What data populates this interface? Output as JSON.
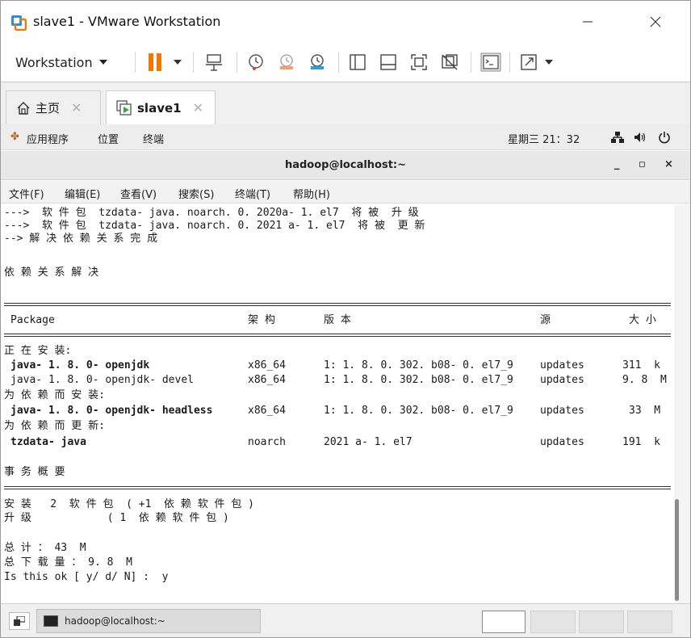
{
  "window": {
    "title": "slave1 - VMware Workstation"
  },
  "toolbar": {
    "workstation_label": "Workstation",
    "accent": "#f07800"
  },
  "tabs": [
    {
      "label": "主页",
      "icon": "home-icon"
    },
    {
      "label": "slave1",
      "icon": "vm-running-icon"
    }
  ],
  "guest_panel": {
    "applications": "应用程序",
    "places": "位置",
    "terminal": "终端",
    "datetime": "星期三 21：32"
  },
  "terminal_window": {
    "title": "hadoop@localhost:~",
    "minimize": "_",
    "maximize": "▫",
    "close": "×"
  },
  "terminal_menu": [
    "文件(F)",
    "编辑(E)",
    "查看(V)",
    "搜索(S)",
    "终端(T)",
    "帮助(H)"
  ],
  "terminal": {
    "lines": [
      "--->  软 件 包  tzdata- java. noarch. 0. 2020a- 1. el7  将 被  升 级",
      "--->  软 件 包  tzdata- java. noarch. 0. 2021 a- 1. el7  将 被  更 新",
      "--> 解 决 依 赖 关 系 完 成",
      "",
      "依 赖 关 系 解 决"
    ],
    "table_header": {
      "package": "Package",
      "arch": "架 构",
      "version": "版 本",
      "repo": "源",
      "size": "大 小"
    },
    "sections": [
      {
        "heading": "正 在 安 装:",
        "rows": [
          {
            "name": "java- 1. 8. 0- openjdk",
            "arch": "x86_64",
            "version": "1: 1. 8. 0. 302. b08- 0. el7_9",
            "repo": "updates",
            "size": "311  k",
            "bold": true
          },
          {
            "name": "java- 1. 8. 0- openjdk- devel",
            "arch": "x86_64",
            "version": "1: 1. 8. 0. 302. b08- 0. el7_9",
            "repo": "updates",
            "size": "9. 8  M",
            "bold": false
          }
        ]
      },
      {
        "heading": "为 依 赖 而 安 装:",
        "rows": [
          {
            "name": "java- 1. 8. 0- openjdk- headless",
            "arch": "x86_64",
            "version": "1: 1. 8. 0. 302. b08- 0. el7_9",
            "repo": "updates",
            "size": "33  M",
            "bold": true
          }
        ]
      },
      {
        "heading": "为 依 赖 而 更 新:",
        "rows": [
          {
            "name": "tzdata- java",
            "arch": "noarch",
            "version": "2021 a- 1. el7",
            "repo": "updates",
            "size": "191  k",
            "bold": true
          }
        ]
      }
    ],
    "summary_title": "事 务 概 要",
    "summary_lines": [
      "安 装   2  软 件 包  ( +1  依 赖 软 件 包 )",
      "升 级            ( 1  依 赖 软 件 包 )",
      "",
      "总 计 ： 43  M",
      "总 下 载 量 ： 9. 8  M",
      "Is this ok [ y/ d/ N] :  y"
    ]
  },
  "statusbar": {
    "task_label": "hadoop@localhost:~"
  }
}
